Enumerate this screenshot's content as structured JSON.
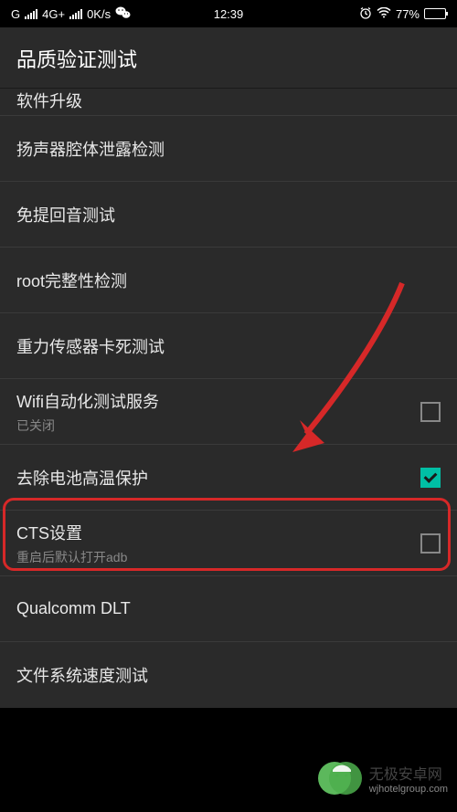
{
  "status": {
    "carrier_prefix": "G",
    "network": "4G+",
    "speed": "0K/s",
    "time": "12:39",
    "battery_percent": "77%"
  },
  "header": {
    "title": "品质验证测试"
  },
  "items": [
    {
      "label": "软件升级",
      "sub": null,
      "checkbox": null
    },
    {
      "label": "扬声器腔体泄露检测",
      "sub": null,
      "checkbox": null
    },
    {
      "label": "免提回音测试",
      "sub": null,
      "checkbox": null
    },
    {
      "label": "root完整性检测",
      "sub": null,
      "checkbox": null
    },
    {
      "label": "重力传感器卡死测试",
      "sub": null,
      "checkbox": null
    },
    {
      "label": "Wifi自动化测试服务",
      "sub": "已关闭",
      "checkbox": false
    },
    {
      "label": "去除电池高温保护",
      "sub": null,
      "checkbox": true
    },
    {
      "label": "CTS设置",
      "sub": "重启后默认打开adb",
      "checkbox": false
    },
    {
      "label": "Qualcomm DLT",
      "sub": null,
      "checkbox": null
    },
    {
      "label": "文件系统速度测试",
      "sub": null,
      "checkbox": null
    }
  ],
  "watermark": {
    "title": "无极安卓网",
    "url": "wjhotelgroup.com"
  }
}
